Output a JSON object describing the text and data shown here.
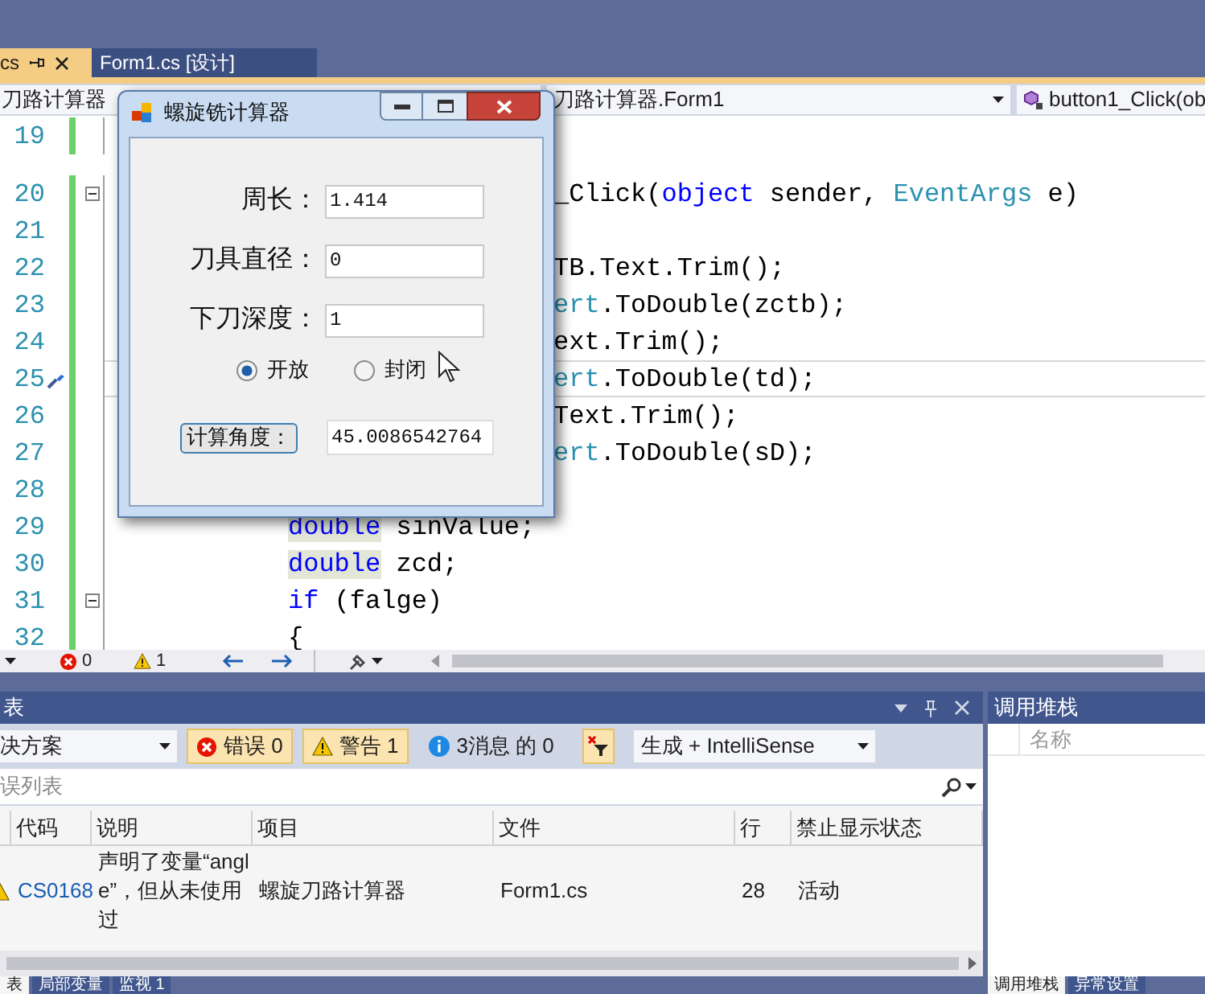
{
  "document_tabs": [
    {
      "label": "cs",
      "selected": true
    },
    {
      "label": "Form1.cs [设计]",
      "selected": false
    }
  ],
  "navigation_bar": {
    "project": "刀路计算器",
    "class": "刀路计算器.Form1",
    "member": "button1_Click(ob"
  },
  "code_editor": {
    "lines": [
      {
        "number": "19",
        "kind": "empty",
        "current": false,
        "collapsible": false,
        "quick_action": false
      },
      {
        "number": "20",
        "kind": "behind-dialog",
        "current": false,
        "collapsible": true,
        "quick_action": false,
        "tokens": [
          {
            "t": "_Click(",
            "kind": "plain"
          },
          {
            "t": "object",
            "kind": "keyword"
          },
          {
            "t": " sender, ",
            "kind": "plain"
          },
          {
            "t": "EventArgs",
            "kind": "type"
          },
          {
            "t": " e)",
            "kind": "plain"
          }
        ]
      },
      {
        "number": "21",
        "kind": "empty",
        "current": false,
        "collapsible": false,
        "quick_action": false
      },
      {
        "number": "22",
        "kind": "behind-dialog",
        "current": false,
        "collapsible": false,
        "quick_action": false,
        "tokens": [
          {
            "t": "TB.Text.Trim();",
            "kind": "plain"
          }
        ]
      },
      {
        "number": "23",
        "kind": "behind-dialog",
        "current": false,
        "collapsible": false,
        "quick_action": false,
        "tokens": [
          {
            "t": "ert",
            "kind": "type"
          },
          {
            "t": ".ToDouble(zctb);",
            "kind": "plain"
          }
        ]
      },
      {
        "number": "24",
        "kind": "behind-dialog",
        "current": false,
        "collapsible": false,
        "quick_action": false,
        "tokens": [
          {
            "t": "ext.Trim();",
            "kind": "plain"
          }
        ]
      },
      {
        "number": "25",
        "kind": "behind-dialog",
        "current": true,
        "collapsible": false,
        "quick_action": true,
        "tokens": [
          {
            "t": "ert",
            "kind": "type"
          },
          {
            "t": ".ToDouble(td);",
            "kind": "plain"
          }
        ]
      },
      {
        "number": "26",
        "kind": "behind-dialog",
        "current": false,
        "collapsible": false,
        "quick_action": false,
        "tokens": [
          {
            "t": "Text.Trim();",
            "kind": "plain"
          }
        ]
      },
      {
        "number": "27",
        "kind": "behind-dialog",
        "current": false,
        "collapsible": false,
        "quick_action": false,
        "tokens": [
          {
            "t": "ert",
            "kind": "type"
          },
          {
            "t": ".ToDouble(sD);",
            "kind": "plain"
          }
        ]
      },
      {
        "number": "28",
        "kind": "empty",
        "current": false,
        "collapsible": false,
        "quick_action": false
      },
      {
        "number": "29",
        "kind": "full",
        "current": false,
        "collapsible": false,
        "quick_action": false,
        "tokens": [
          {
            "t": "double",
            "kind": "reference"
          },
          {
            "t": " sinValue;",
            "kind": "plain"
          }
        ]
      },
      {
        "number": "30",
        "kind": "full",
        "current": false,
        "collapsible": false,
        "quick_action": false,
        "tokens": [
          {
            "t": "double",
            "kind": "reference"
          },
          {
            "t": " zcd;",
            "kind": "plain"
          }
        ]
      },
      {
        "number": "31",
        "kind": "full",
        "current": false,
        "collapsible": true,
        "quick_action": false,
        "tokens": [
          {
            "t": "if",
            "kind": "keyword"
          },
          {
            "t": " (falge)",
            "kind": "plain"
          }
        ]
      },
      {
        "number": "32",
        "kind": "full",
        "current": false,
        "collapsible": false,
        "quick_action": false,
        "tokens": [
          {
            "t": "{",
            "kind": "plain"
          }
        ]
      }
    ]
  },
  "editor_status": {
    "errors": "0",
    "warnings": "1"
  },
  "error_list": {
    "title": "表",
    "scope": "决方案",
    "filters": [
      {
        "kind": "errors",
        "label": "错误 0",
        "selected": true
      },
      {
        "kind": "warnings",
        "label": "警告 1",
        "selected": true
      },
      {
        "kind": "messages",
        "label": "3消息 的 0",
        "selected": false
      }
    ],
    "source": "生成 + IntelliSense",
    "search_placeholder": "误列表",
    "columns": [
      "代码",
      "说明",
      "项目",
      "文件",
      "行",
      "禁止显示状态"
    ],
    "rows": [
      {
        "kind": "warning",
        "code": "CS0168",
        "description": "声明了变量“angle”，但从未使用过",
        "project": "螺旋刀路计算器",
        "file": "Form1.cs",
        "line": "28",
        "suppression": "活动"
      }
    ]
  },
  "bottom_tabs": [
    {
      "label": "表",
      "selected": true
    },
    {
      "label": "局部变量",
      "selected": false
    },
    {
      "label": "监视 1",
      "selected": false
    }
  ],
  "call_stack": {
    "title": "调用堆栈",
    "columns": [
      "名称"
    ],
    "tabs": [
      {
        "label": "调用堆栈",
        "selected": true
      },
      {
        "label": "异常设置",
        "selected": false
      }
    ]
  },
  "dialog": {
    "title": "螺旋铣计算器",
    "fields": [
      {
        "label": "周长：",
        "value": "1.414"
      },
      {
        "label": "刀具直径：",
        "value": "0"
      },
      {
        "label": "下刀深度：",
        "value": "1"
      }
    ],
    "options": [
      {
        "label": "开放",
        "selected": true
      },
      {
        "label": "封闭",
        "selected": false
      }
    ],
    "button": "计算角度：",
    "result": "45.0086542764"
  }
}
